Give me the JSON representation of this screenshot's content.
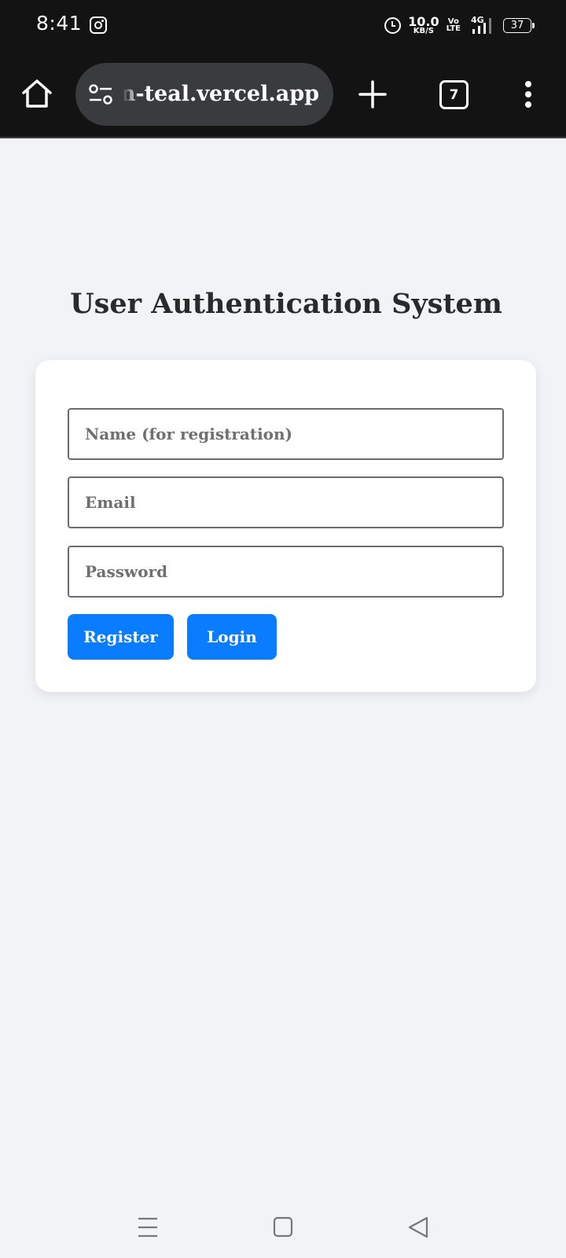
{
  "status_bar": {
    "time": "8:41",
    "speed_value": "10.0",
    "speed_unit": "KB/S",
    "volte_top": "Vo",
    "volte_bottom": "LTE",
    "network": "4G",
    "battery": "37"
  },
  "browser": {
    "url": "user-authentication-teal.vercel.app",
    "tab_count": "7"
  },
  "page": {
    "title": "User Authentication System",
    "form": {
      "name_placeholder": "Name (for registration)",
      "email_placeholder": "Email",
      "password_placeholder": "Password",
      "register_label": "Register",
      "login_label": "Login"
    }
  },
  "colors": {
    "primary_button": "#0a7cff",
    "page_background": "#f1f3f7",
    "chrome_background": "#131313"
  }
}
